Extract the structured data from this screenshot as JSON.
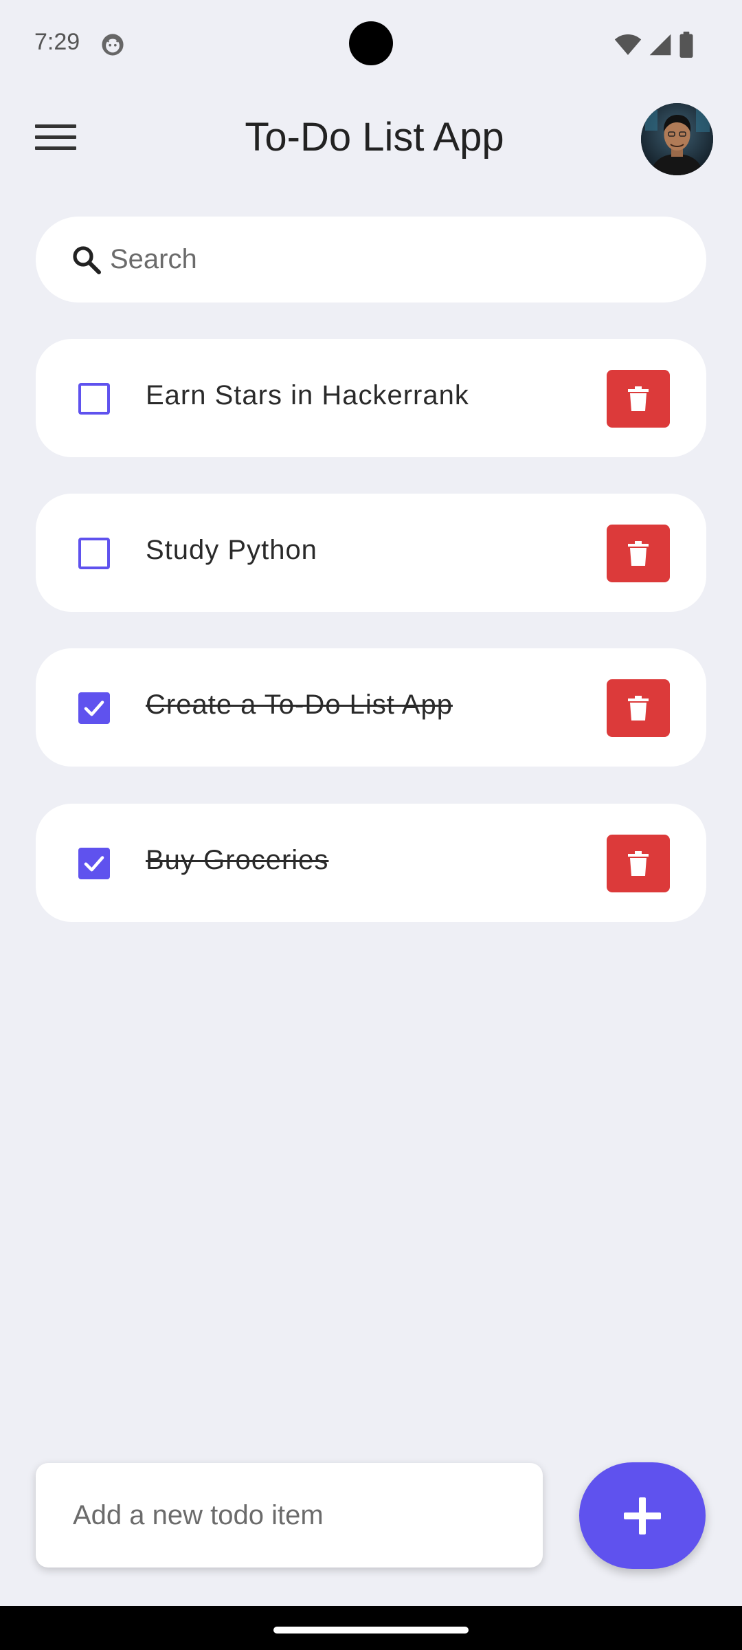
{
  "status_bar": {
    "time": "7:29",
    "app_icon": "android-cat-icon",
    "icons": [
      "wifi-icon",
      "signal-icon",
      "battery-icon"
    ]
  },
  "app_bar": {
    "menu_icon": "hamburger-menu-icon",
    "title": "To-Do List App",
    "avatar": "user-avatar"
  },
  "search": {
    "icon": "search-icon",
    "placeholder": "Search"
  },
  "todos": [
    {
      "text": "Earn Stars in Hackerrank",
      "done": false
    },
    {
      "text": "Study Python",
      "done": false
    },
    {
      "text": "Create a To-Do List App",
      "done": true
    },
    {
      "text": "Buy Groceries",
      "done": true
    }
  ],
  "new_todo": {
    "placeholder": "Add a new todo item"
  },
  "fab": {
    "icon": "plus-icon"
  },
  "colors": {
    "background": "#EEEFF5",
    "accent": "#5F52EE",
    "delete": "#DC3A3A",
    "card": "#FFFFFF"
  }
}
